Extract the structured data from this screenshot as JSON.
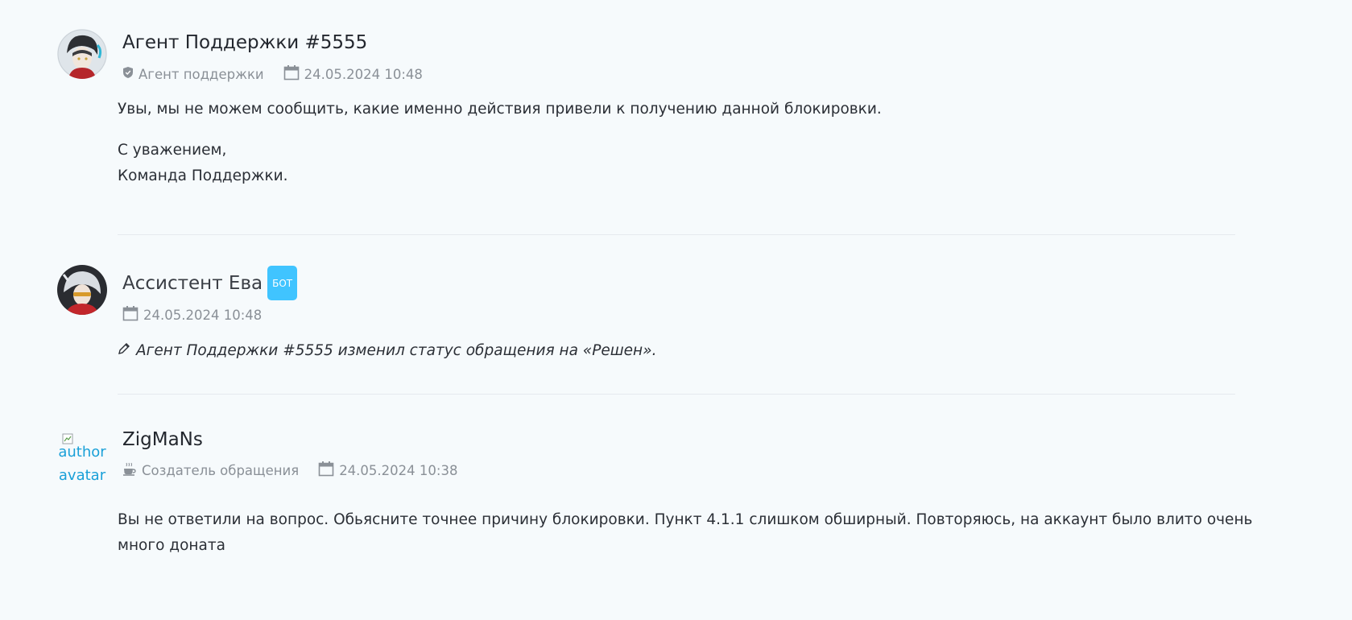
{
  "messages": [
    {
      "author": "Агент Поддержки #5555",
      "role": "Агент поддержки",
      "role_icon": "shield-icon",
      "timestamp": "24.05.2024 10:48",
      "body": [
        "Увы, мы не можем сообщить, какие именно действия привели к получению данной блокировки.",
        "С уважением,",
        "Команда Поддержки."
      ]
    },
    {
      "author": "Ассистент Ева",
      "badge": "БОТ",
      "timestamp": "24.05.2024 10:48",
      "event_text": "Агент Поддержки #5555 изменил статус обращения на «Решен».",
      "event_icon": "pencil-icon"
    },
    {
      "author": "ZigMaNs",
      "avatar_alt": "author avatar",
      "role": "Создатель обращения",
      "role_icon": "coffee-cup-icon",
      "timestamp": "24.05.2024 10:38",
      "body": [
        "Вы не ответили на вопрос. Обьясните точнее причину блокировки. Пункт 4.1.1 слишком обширный. Повторяюсь, на аккаунт было влито очень",
        "много доната"
      ]
    }
  ],
  "colors": {
    "background": "#f6fafc",
    "badge": "#40c4ff",
    "meta_text": "#8a9097",
    "divider": "#e6eaee",
    "link_alt": "#1aa0d8"
  }
}
